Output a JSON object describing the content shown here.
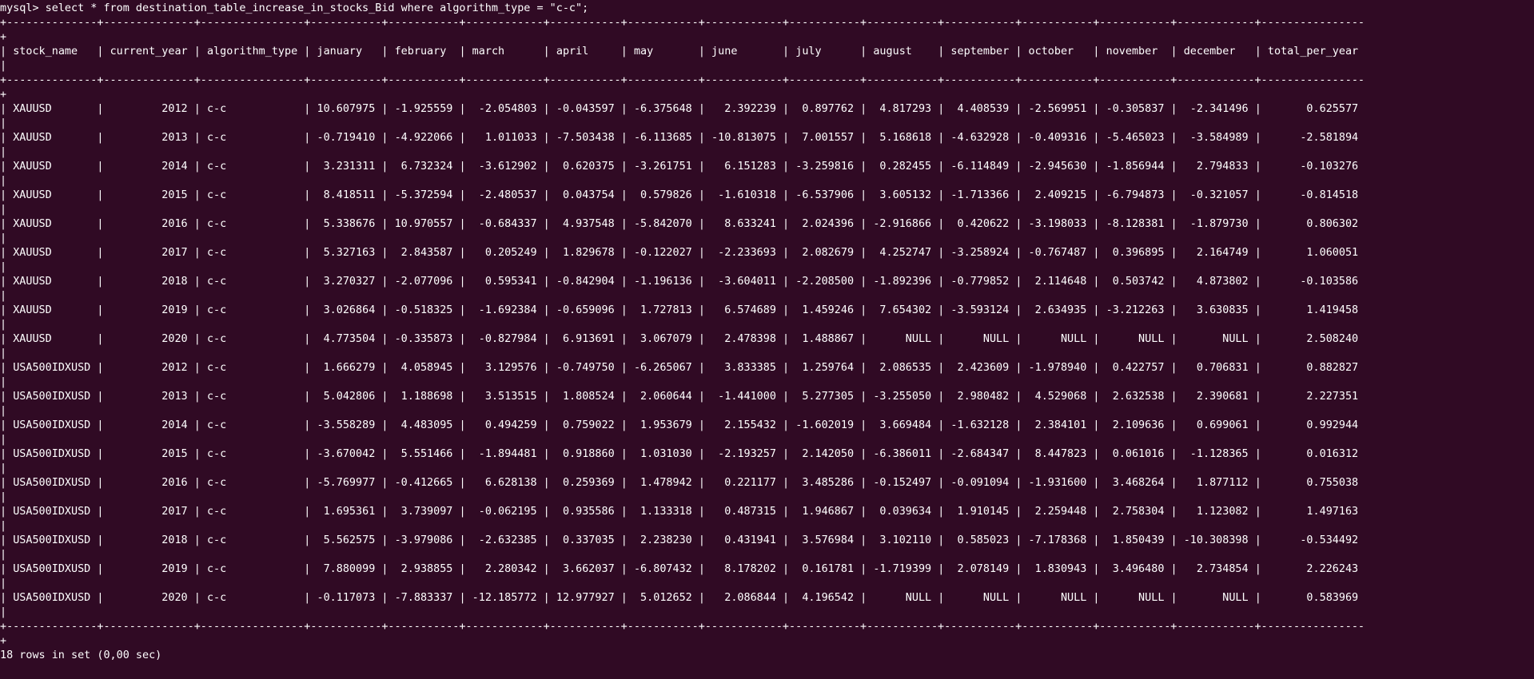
{
  "terminal": {
    "prompt": "mysql> ",
    "command": "select * from destination_table_increase_in_stocks_Bid where algorithm_type = \"c-c\";"
  },
  "table": {
    "columns": [
      "stock_name",
      "current_year",
      "algorithm_type",
      "january",
      "february",
      "march",
      "april",
      "may",
      "june",
      "july",
      "august",
      "september",
      "october",
      "november",
      "december",
      "total_per_year"
    ],
    "numeric_columns": [
      false,
      true,
      false,
      true,
      true,
      true,
      true,
      true,
      true,
      true,
      true,
      true,
      true,
      true,
      true,
      true
    ],
    "rows": [
      [
        "XAUUSD",
        "2012",
        "c-c",
        "10.607975",
        "-1.925559",
        "-2.054803",
        "-0.043597",
        "-6.375648",
        "2.392239",
        "0.897762",
        "4.817293",
        "4.408539",
        "-2.569951",
        "-0.305837",
        "-2.341496",
        "0.625577"
      ],
      [
        "XAUUSD",
        "2013",
        "c-c",
        "-0.719410",
        "-4.922066",
        "1.011033",
        "-7.503438",
        "-6.113685",
        "-10.813075",
        "7.001557",
        "5.168618",
        "-4.632928",
        "-0.409316",
        "-5.465023",
        "-3.584989",
        "-2.581894"
      ],
      [
        "XAUUSD",
        "2014",
        "c-c",
        "3.231311",
        "6.732324",
        "-3.612902",
        "0.620375",
        "-3.261751",
        "6.151283",
        "-3.259816",
        "0.282455",
        "-6.114849",
        "-2.945630",
        "-1.856944",
        "2.794833",
        "-0.103276"
      ],
      [
        "XAUUSD",
        "2015",
        "c-c",
        "8.418511",
        "-5.372594",
        "-2.480537",
        "0.043754",
        "0.579826",
        "-1.610318",
        "-6.537906",
        "3.605132",
        "-1.713366",
        "2.409215",
        "-6.794873",
        "-0.321057",
        "-0.814518"
      ],
      [
        "XAUUSD",
        "2016",
        "c-c",
        "5.338676",
        "10.970557",
        "-0.684337",
        "4.937548",
        "-5.842070",
        "8.633241",
        "2.024396",
        "-2.916866",
        "0.420622",
        "-3.198033",
        "-8.128381",
        "-1.879730",
        "0.806302"
      ],
      [
        "XAUUSD",
        "2017",
        "c-c",
        "5.327163",
        "2.843587",
        "0.205249",
        "1.829678",
        "-0.122027",
        "-2.233693",
        "2.082679",
        "4.252747",
        "-3.258924",
        "-0.767487",
        "0.396895",
        "2.164749",
        "1.060051"
      ],
      [
        "XAUUSD",
        "2018",
        "c-c",
        "3.270327",
        "-2.077096",
        "0.595341",
        "-0.842904",
        "-1.196136",
        "-3.604011",
        "-2.208500",
        "-1.892396",
        "-0.779852",
        "2.114648",
        "0.503742",
        "4.873802",
        "-0.103586"
      ],
      [
        "XAUUSD",
        "2019",
        "c-c",
        "3.026864",
        "-0.518325",
        "-1.692384",
        "-0.659096",
        "1.727813",
        "6.574689",
        "1.459246",
        "7.654302",
        "-3.593124",
        "2.634935",
        "-3.212263",
        "3.630835",
        "1.419458"
      ],
      [
        "XAUUSD",
        "2020",
        "c-c",
        "4.773504",
        "-0.335873",
        "-0.827984",
        "6.913691",
        "3.067079",
        "2.478398",
        "1.488867",
        "NULL",
        "NULL",
        "NULL",
        "NULL",
        "NULL",
        "2.508240"
      ],
      [
        "USA500IDXUSD",
        "2012",
        "c-c",
        "1.666279",
        "4.058945",
        "3.129576",
        "-0.749750",
        "-6.265067",
        "3.833385",
        "1.259764",
        "2.086535",
        "2.423609",
        "-1.978940",
        "0.422757",
        "0.706831",
        "0.882827"
      ],
      [
        "USA500IDXUSD",
        "2013",
        "c-c",
        "5.042806",
        "1.188698",
        "3.513515",
        "1.808524",
        "2.060644",
        "-1.441000",
        "5.277305",
        "-3.255050",
        "2.980482",
        "4.529068",
        "2.632538",
        "2.390681",
        "2.227351"
      ],
      [
        "USA500IDXUSD",
        "2014",
        "c-c",
        "-3.558289",
        "4.483095",
        "0.494259",
        "0.759022",
        "1.953679",
        "2.155432",
        "-1.602019",
        "3.669484",
        "-1.632128",
        "2.384101",
        "2.109636",
        "0.699061",
        "0.992944"
      ],
      [
        "USA500IDXUSD",
        "2015",
        "c-c",
        "-3.670042",
        "5.551466",
        "-1.894481",
        "0.918860",
        "1.031030",
        "-2.193257",
        "2.142050",
        "-6.386011",
        "-2.684347",
        "8.447823",
        "0.061016",
        "-1.128365",
        "0.016312"
      ],
      [
        "USA500IDXUSD",
        "2016",
        "c-c",
        "-5.769977",
        "-0.412665",
        "6.628138",
        "0.259369",
        "1.478942",
        "0.221177",
        "3.485286",
        "-0.152497",
        "-0.091094",
        "-1.931600",
        "3.468264",
        "1.877112",
        "0.755038"
      ],
      [
        "USA500IDXUSD",
        "2017",
        "c-c",
        "1.695361",
        "3.739097",
        "-0.062195",
        "0.935586",
        "1.133318",
        "0.487315",
        "1.946867",
        "0.039634",
        "1.910145",
        "2.259448",
        "2.758304",
        "1.123082",
        "1.497163"
      ],
      [
        "USA500IDXUSD",
        "2018",
        "c-c",
        "5.562575",
        "-3.979086",
        "-2.632385",
        "0.337035",
        "2.238230",
        "0.431941",
        "3.576984",
        "3.102110",
        "0.585023",
        "-7.178368",
        "1.850439",
        "-10.308398",
        "-0.534492"
      ],
      [
        "USA500IDXUSD",
        "2019",
        "c-c",
        "7.880099",
        "2.938855",
        "2.280342",
        "3.662037",
        "-6.807432",
        "8.178202",
        "0.161781",
        "-1.719399",
        "2.078149",
        "1.830943",
        "3.496480",
        "2.734854",
        "2.226243"
      ],
      [
        "USA500IDXUSD",
        "2020",
        "c-c",
        "-0.117073",
        "-7.883337",
        "-12.185772",
        "12.977927",
        "5.012652",
        "2.086844",
        "4.196542",
        "NULL",
        "NULL",
        "NULL",
        "NULL",
        "NULL",
        "0.583969"
      ]
    ]
  },
  "footer": {
    "status": "18 rows in set (0,00 sec)"
  }
}
